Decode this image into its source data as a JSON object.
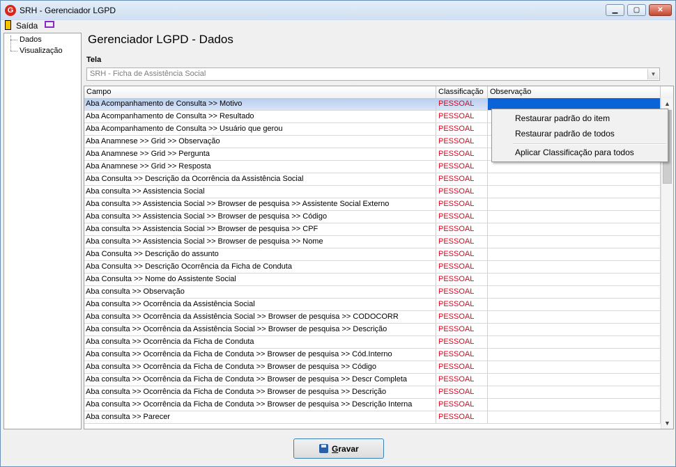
{
  "window": {
    "title": "SRH - Gerenciador LGPD",
    "app_icon_letter": "G",
    "minimize_glyph": "▁",
    "maximize_glyph": "▢",
    "close_glyph": "✕"
  },
  "menubar": {
    "exit_label": "Saída"
  },
  "tree": {
    "items": [
      {
        "label": "Dados"
      },
      {
        "label": "Visualização"
      }
    ]
  },
  "main": {
    "title": "Gerenciador LGPD - Dados",
    "tela_label": "Tela",
    "tela_value": "SRH - Ficha de Assistência Social"
  },
  "grid": {
    "headers": {
      "campo": "Campo",
      "classificacao": "Classificação",
      "observacao": "Observação"
    },
    "rows": [
      {
        "campo": "Aba Acompanhamento de Consulta >> Motivo",
        "classificacao": "PESSOAL",
        "observacao": ""
      },
      {
        "campo": "Aba Acompanhamento de Consulta >> Resultado",
        "classificacao": "PESSOAL",
        "observacao": ""
      },
      {
        "campo": "Aba Acompanhamento de Consulta >> Usuário que gerou",
        "classificacao": "PESSOAL",
        "observacao": ""
      },
      {
        "campo": "Aba Anamnese >> Grid >> Observação",
        "classificacao": "PESSOAL",
        "observacao": ""
      },
      {
        "campo": "Aba Anamnese >> Grid >> Pergunta",
        "classificacao": "PESSOAL",
        "observacao": ""
      },
      {
        "campo": "Aba Anamnese >> Grid >> Resposta",
        "classificacao": "PESSOAL",
        "observacao": ""
      },
      {
        "campo": "Aba Consulta >>  Descrição da Ocorrência da Assistência Social",
        "classificacao": "PESSOAL",
        "observacao": ""
      },
      {
        "campo": "Aba consulta >> Assistencia Social",
        "classificacao": "PESSOAL",
        "observacao": ""
      },
      {
        "campo": "Aba consulta >> Assistencia Social >> Browser de pesquisa >> Assistente Social Externo",
        "classificacao": "PESSOAL",
        "observacao": ""
      },
      {
        "campo": "Aba consulta >> Assistencia Social >> Browser de pesquisa >> Código",
        "classificacao": "PESSOAL",
        "observacao": ""
      },
      {
        "campo": "Aba consulta >> Assistencia Social >> Browser de pesquisa >> CPF",
        "classificacao": "PESSOAL",
        "observacao": ""
      },
      {
        "campo": "Aba consulta >> Assistencia Social >> Browser de pesquisa >> Nome",
        "classificacao": "PESSOAL",
        "observacao": ""
      },
      {
        "campo": "Aba Consulta >> Descrição do assunto",
        "classificacao": "PESSOAL",
        "observacao": ""
      },
      {
        "campo": "Aba Consulta >> Descrição Ocorrência da Ficha de Conduta",
        "classificacao": "PESSOAL",
        "observacao": ""
      },
      {
        "campo": "Aba Consulta >> Nome do Assistente Social",
        "classificacao": "PESSOAL",
        "observacao": ""
      },
      {
        "campo": "Aba consulta >> Observação",
        "classificacao": "PESSOAL",
        "observacao": ""
      },
      {
        "campo": "Aba consulta >> Ocorrência da Assistência Social",
        "classificacao": "PESSOAL",
        "observacao": ""
      },
      {
        "campo": "Aba consulta >> Ocorrência da Assistência Social >> Browser de pesquisa >> CODOCORR",
        "classificacao": "PESSOAL",
        "observacao": ""
      },
      {
        "campo": "Aba consulta >> Ocorrência da Assistência Social >> Browser de pesquisa >> Descrição",
        "classificacao": "PESSOAL",
        "observacao": ""
      },
      {
        "campo": "Aba consulta >> Ocorrência da Ficha de Conduta",
        "classificacao": "PESSOAL",
        "observacao": ""
      },
      {
        "campo": "Aba consulta >> Ocorrência da Ficha de Conduta >> Browser de pesquisa >> Cód.Interno",
        "classificacao": "PESSOAL",
        "observacao": ""
      },
      {
        "campo": "Aba consulta >> Ocorrência da Ficha de Conduta >> Browser de pesquisa >> Código",
        "classificacao": "PESSOAL",
        "observacao": ""
      },
      {
        "campo": "Aba consulta >> Ocorrência da Ficha de Conduta >> Browser de pesquisa >> Descr Completa",
        "classificacao": "PESSOAL",
        "observacao": ""
      },
      {
        "campo": "Aba consulta >> Ocorrência da Ficha de Conduta >> Browser de pesquisa >> Descrição",
        "classificacao": "PESSOAL",
        "observacao": ""
      },
      {
        "campo": "Aba consulta >> Ocorrência da Ficha de Conduta >> Browser de pesquisa >> Descrição Interna",
        "classificacao": "PESSOAL",
        "observacao": ""
      },
      {
        "campo": "Aba consulta >> Parecer",
        "classificacao": "PESSOAL",
        "observacao": ""
      }
    ]
  },
  "context_menu": {
    "items": [
      {
        "label": "Restaurar padrão do item"
      },
      {
        "label": "Restaurar padrão de todos"
      },
      {
        "label": "Aplicar Classificação para todos"
      }
    ]
  },
  "footer": {
    "save_label_underlined": "G",
    "save_label_rest": "ravar"
  },
  "colors": {
    "classification_text": "#e8001c",
    "selected_row": "#b7cdef",
    "selected_cell": "#0a64d8"
  }
}
